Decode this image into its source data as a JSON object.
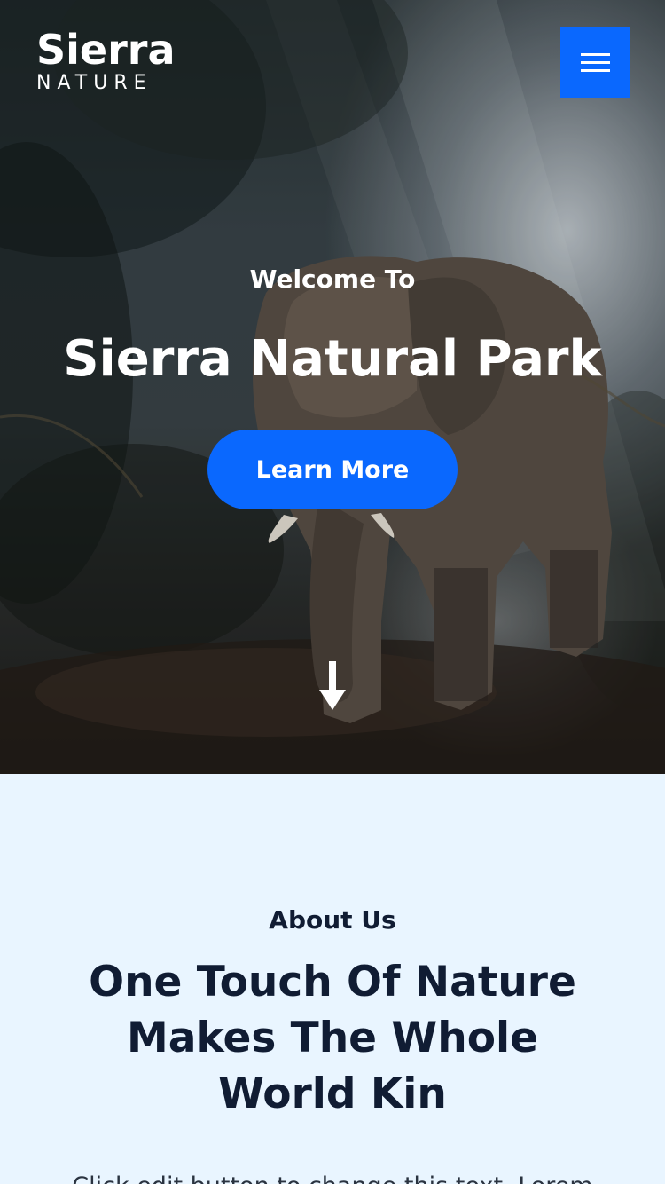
{
  "header": {
    "logo_main": "Sierra",
    "logo_sub": "NATURE",
    "menu_icon": "hamburger-menu-icon"
  },
  "hero": {
    "welcome": "Welcome To",
    "title": "Sierra Natural Park",
    "cta_label": "Learn More",
    "scroll_icon": "arrow-down-icon"
  },
  "about": {
    "eyebrow": "About Us",
    "heading": "One Touch Of Nature Makes The Whole World Kin",
    "body": "Click edit button to change this text. Lorem"
  },
  "colors": {
    "accent": "#0a68fe",
    "about_background": "#e9f5ff",
    "heading_text": "#101c33"
  }
}
